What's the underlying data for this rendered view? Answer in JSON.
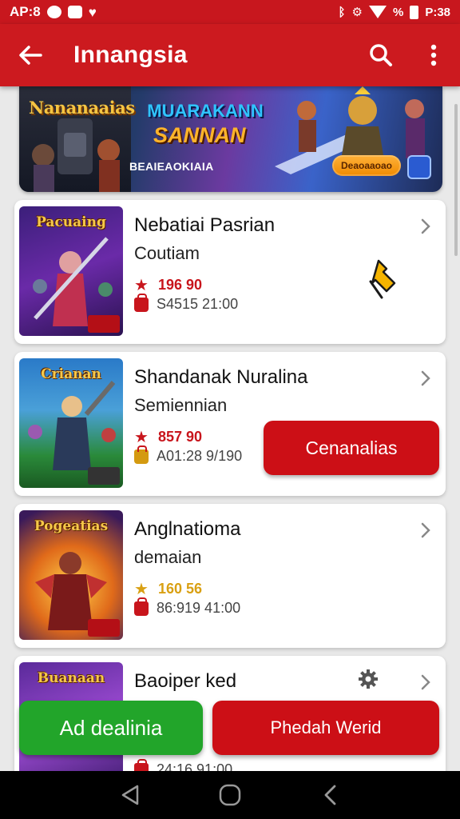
{
  "status_bar": {
    "time_left": "AP:8",
    "battery": "%",
    "time_right": "P:38",
    "icons": [
      "youtube-icon",
      "mail-icon",
      "heart-icon",
      "bluetooth-icon",
      "settings-icon",
      "wifi-icon",
      "battery-icon"
    ]
  },
  "app_bar": {
    "title": "Innangsia",
    "color": "#cc1a1f",
    "icons": [
      "back-arrow-icon",
      "search-icon",
      "more-vert-icon"
    ]
  },
  "banner": {
    "logo": "Nananaaias",
    "headline_top": "MUARAKANN",
    "headline_main": "SANNAN",
    "subtitle": "BEAIEAOKIAIA",
    "cta": "Deaoaaoao"
  },
  "cards": [
    {
      "title": "Nebatiai Pasrian",
      "subtitle": "Coutiam",
      "rating": "196 90",
      "meta": "S4515  21:00",
      "thumb_title": "Pacuaing",
      "star_color": "#c8151c"
    },
    {
      "title": "Shandanak Nuralina",
      "subtitle": "Semiennian",
      "rating": "857 90",
      "meta": "A01:28  9/190",
      "thumb_title": "Crianan",
      "install_label": "Cenanalias",
      "star_color": "#c8151c"
    },
    {
      "title": "Anglnatioma",
      "subtitle": "demaian",
      "rating": "160 56",
      "meta": "86:919  41:00",
      "thumb_title": "Pogeatias",
      "star_color": "#e0a21a"
    },
    {
      "title": "Baoiper ked",
      "subtitle": "",
      "meta": "24:16  91:00",
      "thumb_title": "Buanaan"
    }
  ],
  "bottom_buttons": {
    "left": "Ad dealinia",
    "right": "Phedah Werid"
  },
  "colors": {
    "accent": "#cc1a1f",
    "green": "#22a52a"
  }
}
